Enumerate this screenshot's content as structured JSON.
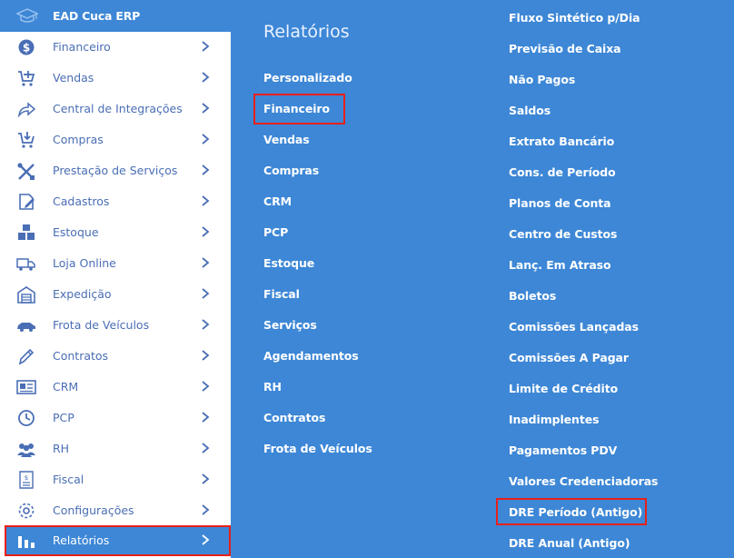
{
  "app": {
    "title": "EAD Cuca ERP",
    "icon": "graduation-cap-icon",
    "accent_color": "#3d87d6",
    "highlight_color": "#e8201a"
  },
  "sidebar": {
    "items": [
      {
        "label": "Financeiro",
        "icon": "dollar-coin-icon"
      },
      {
        "label": "Vendas",
        "icon": "cart-plus-icon"
      },
      {
        "label": "Central de Integrações",
        "icon": "share-arrow-icon"
      },
      {
        "label": "Compras",
        "icon": "cart-download-icon"
      },
      {
        "label": "Prestação de Serviços",
        "icon": "tools-icon"
      },
      {
        "label": "Cadastros",
        "icon": "edit-document-icon"
      },
      {
        "label": "Estoque",
        "icon": "boxes-icon"
      },
      {
        "label": "Loja Online",
        "icon": "delivery-truck-icon"
      },
      {
        "label": "Expedição",
        "icon": "warehouse-icon"
      },
      {
        "label": "Frota de Veículos",
        "icon": "car-icon"
      },
      {
        "label": "Contratos",
        "icon": "pen-icon"
      },
      {
        "label": "CRM",
        "icon": "id-card-icon"
      },
      {
        "label": "PCP",
        "icon": "clock-icon"
      },
      {
        "label": "RH",
        "icon": "users-icon"
      },
      {
        "label": "Fiscal",
        "icon": "receipt-icon"
      },
      {
        "label": "Configurações",
        "icon": "gear-icon"
      },
      {
        "label": "Relatórios",
        "icon": "bar-chart-icon",
        "active": true
      }
    ]
  },
  "panel": {
    "title": "Relatórios",
    "categories": [
      "Personalizado",
      "Financeiro",
      "Vendas",
      "Compras",
      "CRM",
      "PCP",
      "Estoque",
      "Fiscal",
      "Serviços",
      "Agendamentos",
      "RH",
      "Contratos",
      "Frota de Veículos"
    ],
    "reports": [
      "Fluxo Sintético p/Dia",
      "Previsão de Caixa",
      "Não Pagos",
      "Saldos",
      "Extrato Bancário",
      "Cons. de Período",
      "Planos de Conta",
      "Centro de Custos",
      "Lanç. Em Atraso",
      "Boletos",
      "Comissões Lançadas",
      "Comissões A Pagar",
      "Limite de Crédito",
      "Inadimplentes",
      "Pagamentos PDV",
      "Valores Credenciadoras",
      "DRE Período (Antigo)",
      "DRE Anual (Antigo)"
    ]
  }
}
